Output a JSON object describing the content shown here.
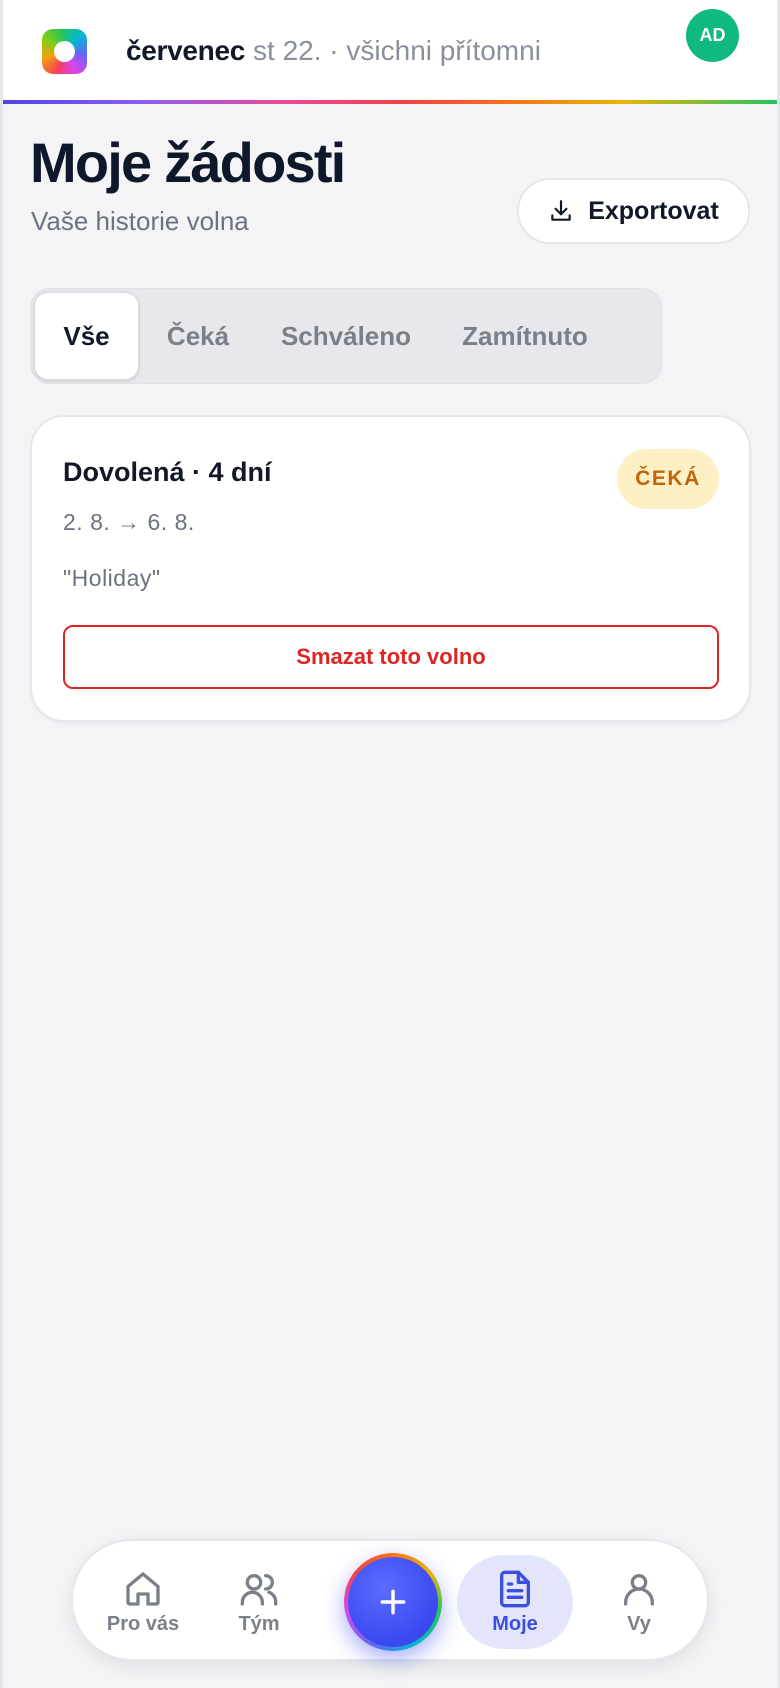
{
  "header": {
    "month": "červenec",
    "day_status": "st 22. · všichni přítomni",
    "avatar_initials": "AD"
  },
  "page": {
    "title": "Moje žádosti",
    "subtitle": "Vaše historie volna",
    "export_label": "Exportovat"
  },
  "tabs": [
    {
      "label": "Vše",
      "active": true
    },
    {
      "label": "Čeká",
      "active": false
    },
    {
      "label": "Schváleno",
      "active": false
    },
    {
      "label": "Zamítnuto",
      "active": false
    }
  ],
  "requests": [
    {
      "title": "Dovolená · 4 dní",
      "status": "ČEKÁ",
      "dates": "2. 8. → 6. 8.",
      "note": "\"Holiday\"",
      "delete_label": "Smazat toto volno"
    }
  ],
  "bottom_nav": {
    "items": [
      {
        "label": "Pro vás",
        "icon": "home-icon",
        "active": false
      },
      {
        "label": "Tým",
        "icon": "team-icon",
        "active": false
      },
      {
        "label": "Moje",
        "icon": "document-icon",
        "active": true
      },
      {
        "label": "Vy",
        "icon": "user-icon",
        "active": false
      }
    ],
    "fab_icon": "plus-icon"
  },
  "colors": {
    "accent": "#3b4fe0",
    "danger": "#dc2626",
    "pending_bg": "#fdf0c4",
    "pending_text": "#c2640c",
    "avatar": "#10b981"
  }
}
